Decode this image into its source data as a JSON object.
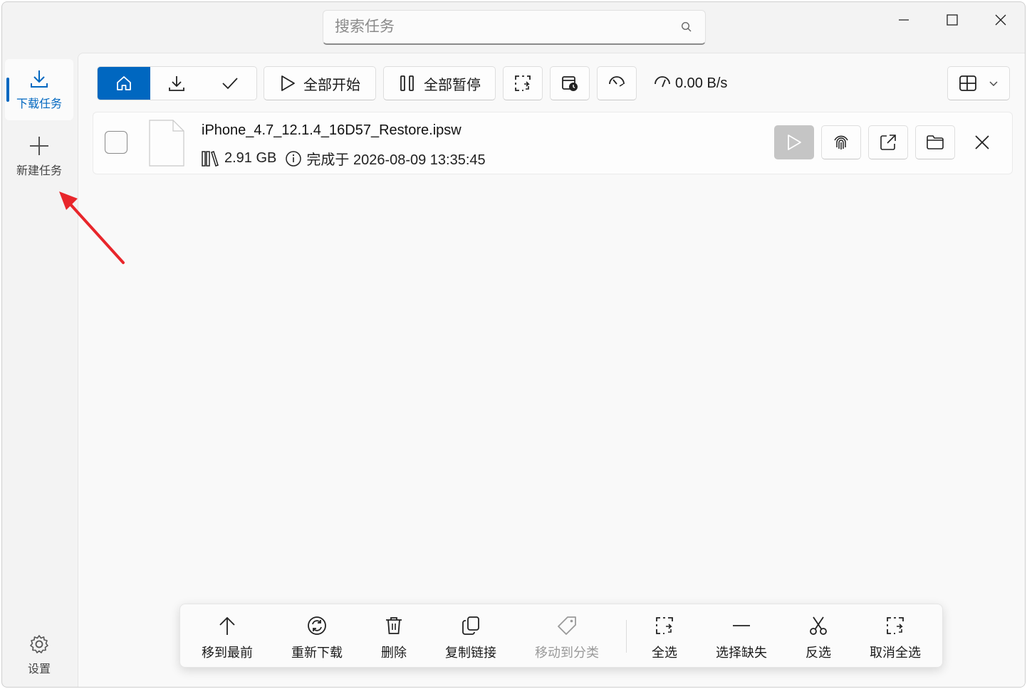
{
  "titlebar": {
    "search_placeholder": "搜索任务",
    "icons": [
      "search-icon",
      "minimize-icon",
      "maximize-icon",
      "close-icon"
    ]
  },
  "sidebar": {
    "items": [
      {
        "label": "下载任务",
        "icon": "download-icon",
        "active": true
      },
      {
        "label": "新建任务",
        "icon": "plus-icon",
        "active": false
      }
    ],
    "settings_label": "设置"
  },
  "toolbar": {
    "filters": [
      "home-icon",
      "download-icon",
      "check-icon"
    ],
    "start_all": "全部开始",
    "pause_all": "全部暂停",
    "speed": "0.00 B/s",
    "accent": "#0067c0"
  },
  "tasks": [
    {
      "filename": "iPhone_4.7_12.1.4_16D57_Restore.ipsw",
      "size": "2.91 GB",
      "status": "完成于 2026-08-09 13:35:45"
    }
  ],
  "commandbar": {
    "items": [
      {
        "label": "移到最前",
        "icon": "arrow-up-icon",
        "disabled": false
      },
      {
        "label": "重新下载",
        "icon": "refresh-icon",
        "disabled": false
      },
      {
        "label": "删除",
        "icon": "trash-icon",
        "disabled": false
      },
      {
        "label": "复制链接",
        "icon": "copy-icon",
        "disabled": false
      },
      {
        "label": "移动到分类",
        "icon": "tag-icon",
        "disabled": true
      },
      {
        "label": "全选",
        "icon": "select-all-icon",
        "disabled": false
      },
      {
        "label": "选择缺失",
        "icon": "minus-icon",
        "disabled": false
      },
      {
        "label": "反选",
        "icon": "scissors-icon",
        "disabled": false
      },
      {
        "label": "取消全选",
        "icon": "deselect-icon",
        "disabled": false
      }
    ]
  },
  "annotation_color": "#e8262b"
}
